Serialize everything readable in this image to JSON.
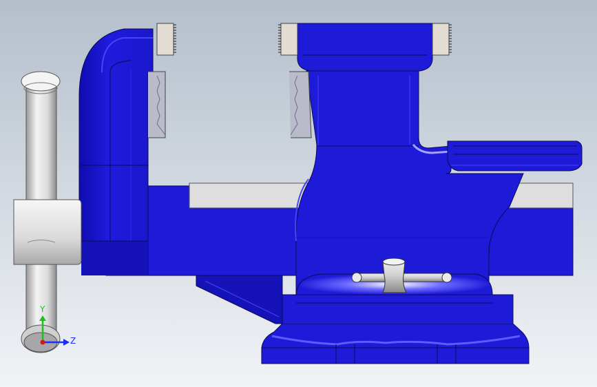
{
  "viewport": {
    "background_top": "#b4bfcb",
    "background_bottom": "#f1f3f6"
  },
  "colors": {
    "body_blue": "#1d1ad8",
    "body_blue_dark": "#0c0a9c",
    "body_blue_light": "#4744ff",
    "edge": "#0a0a55",
    "metal_light": "#f2f2f2",
    "metal_mid": "#d4d4d4",
    "metal_dark": "#8d8d8d",
    "slide_bar": "#dedede"
  },
  "triad": {
    "y_label": "Y",
    "z_label": "Z",
    "y_color": "#1fbf1f",
    "z_color": "#1a2cff",
    "x_color": "#d21a1a",
    "icon": "coordinate-triad-icon"
  }
}
